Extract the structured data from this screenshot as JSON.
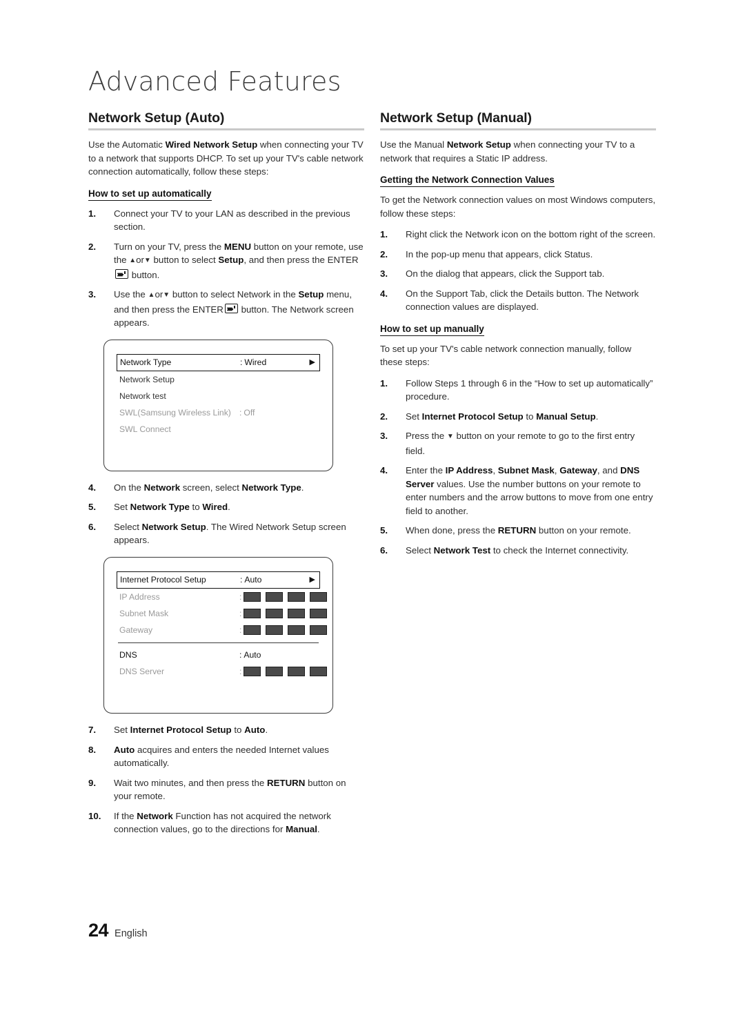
{
  "chapter": {
    "title": "Advanced Features"
  },
  "footer": {
    "page_number": "24",
    "language": "English"
  },
  "left": {
    "heading": "Network Setup (Auto)",
    "intro_1": "Use the Automatic ",
    "intro_1_b": "Wired Network Setup",
    "intro_1_c": " when connecting your TV to a network that supports DHCP. To set up your TV's cable network connection automatically, follow these steps:",
    "subheading": "How to set up automatically",
    "steps": [
      {
        "num": "1.",
        "text": "Connect your TV to your LAN as described in the previous section."
      },
      {
        "num": "2.",
        "text": "Turn on your TV, press the MENU button on your remote, use the ▲or▼ button to select Setup, and then press the ENTER button."
      },
      {
        "num": "3.",
        "text": "Use the ▲or▼ button to select Network in the Setup menu, and then press the ENTER button. The Network screen appears."
      },
      {
        "num": "4.",
        "text": "On the Network screen, select Network Type."
      },
      {
        "num": "5.",
        "text": "Set Network Type to Wired."
      },
      {
        "num": "6.",
        "text": "Select Network Setup. The Wired Network Setup screen appears."
      },
      {
        "num": "7.",
        "text": "Set Internet Protocol Setup to Auto."
      },
      {
        "num": "8.",
        "text": "Auto acquires and enters the needed Internet values automatically."
      },
      {
        "num": "9.",
        "text": "Wait two minutes, and then press the RETURN button on your remote."
      },
      {
        "num": "10.",
        "text": "If the Network Function has not acquired the network connection values, go to the directions for Manual."
      }
    ]
  },
  "right": {
    "heading": "Network Setup (Manual)",
    "intro": "Use the Manual Network Setup when connecting your TV to a network that requires a Static IP address.",
    "subheading_values": "Getting the Network Connection Values",
    "values_intro": "To get the Network connection values on most Windows computers, follow these steps:",
    "values_steps": [
      {
        "num": "1.",
        "text": "Right click the Network icon on the bottom right of the screen."
      },
      {
        "num": "2.",
        "text": "In the pop-up menu that appears, click Status."
      },
      {
        "num": "3.",
        "text": "On the dialog that appears, click the Support tab."
      },
      {
        "num": "4.",
        "text": "On the Support Tab, click the Details button. The Network connection values are displayed."
      }
    ],
    "subheading_manual": "How to set up manually",
    "manual_intro": "To set up your TV's cable network connection manually, follow these steps:",
    "manual_steps": [
      {
        "num": "1.",
        "text": "Follow Steps 1 through 6 in the “How to set up automatically” procedure."
      },
      {
        "num": "2.",
        "text": "Set Internet Protocol Setup to Manual Setup."
      },
      {
        "num": "3.",
        "text": "Press the ▼ button on your remote to go to the first entry field."
      },
      {
        "num": "4.",
        "text": "Enter the IP Address, Subnet Mask, Gateway, and DNS Server values. Use the number buttons on your remote to enter numbers and the arrow buttons to move from one entry field to another."
      },
      {
        "num": "5.",
        "text": "When done, press the RETURN button on your remote."
      },
      {
        "num": "6.",
        "text": "Select Network Test to check the Internet connectivity."
      }
    ]
  },
  "osd_network": {
    "rows": [
      {
        "label": "Network Type",
        "colon": ":",
        "value": "Wired",
        "state": "highlight",
        "caret": "▶"
      },
      {
        "label": "Network Setup",
        "colon": "",
        "value": "",
        "state": "normal",
        "caret": ""
      },
      {
        "label": "Network test",
        "colon": "",
        "value": "",
        "state": "normal",
        "caret": ""
      },
      {
        "label": "SWL(Samsung Wireless Link)",
        "colon": ":",
        "value": "Off",
        "state": "dim",
        "caret": ""
      },
      {
        "label": "SWL Connect",
        "colon": "",
        "value": "",
        "state": "dim",
        "caret": ""
      }
    ]
  },
  "osd_ip": {
    "rows": [
      {
        "label": "Internet Protocol Setup",
        "colon": ":",
        "value": "Auto",
        "state": "highlight",
        "caret": "▶",
        "octets": 0
      },
      {
        "label": "IP Address",
        "colon": ":",
        "value": "",
        "state": "dim",
        "caret": "",
        "octets": 4
      },
      {
        "label": "Subnet Mask",
        "colon": ":",
        "value": "",
        "state": "dim",
        "caret": "",
        "octets": 4
      },
      {
        "label": "Gateway",
        "colon": ":",
        "value": "",
        "state": "dim",
        "caret": "",
        "octets": 4
      },
      {
        "label": "__DIVIDER__",
        "colon": "",
        "value": "",
        "state": "divider",
        "caret": "",
        "octets": 0
      },
      {
        "label": "DNS",
        "colon": ":",
        "value": "Auto",
        "state": "strong",
        "caret": "",
        "octets": 0
      },
      {
        "label": "DNS Server",
        "colon": ":",
        "value": "",
        "state": "dim",
        "caret": "",
        "octets": 4
      }
    ]
  },
  "colors": {
    "heading_rule": "#c9c9c9",
    "osd_border": "#3a3a3a",
    "octet_fill": "#4a4a4a",
    "dim_text": "#9a9a9a"
  }
}
